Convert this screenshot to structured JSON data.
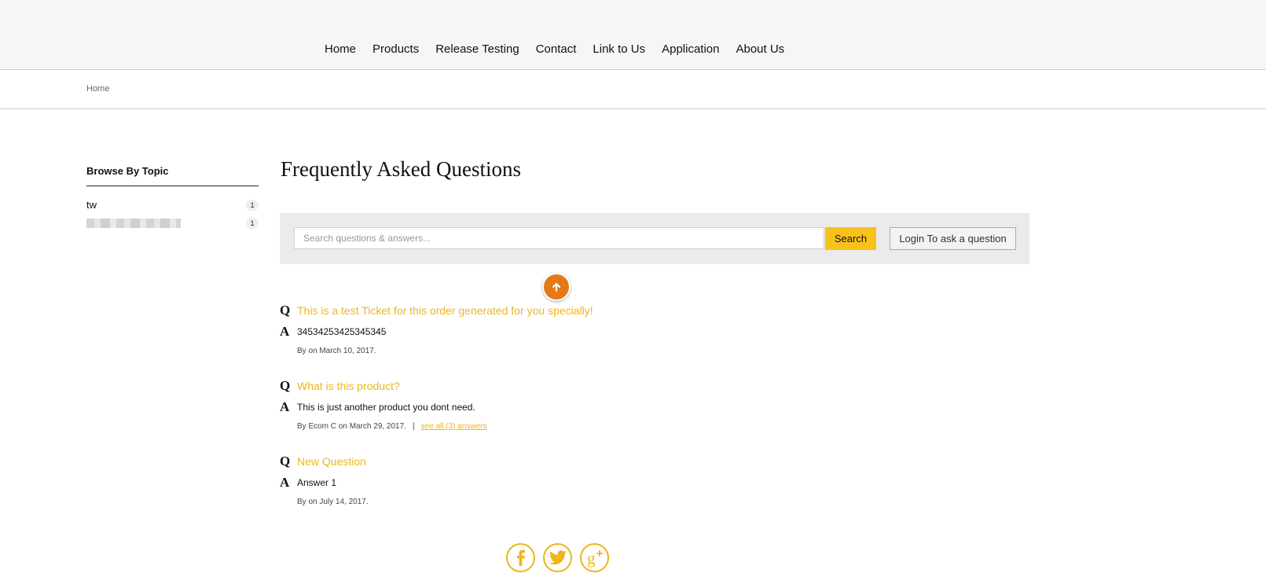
{
  "nav": {
    "items": [
      {
        "label": "Home"
      },
      {
        "label": "Products"
      },
      {
        "label": "Release Testing"
      },
      {
        "label": "Contact"
      },
      {
        "label": "Link to Us"
      },
      {
        "label": "Application"
      },
      {
        "label": "About Us"
      }
    ]
  },
  "breadcrumb": {
    "home": "Home"
  },
  "sidebar": {
    "title": "Browse By Topic",
    "topics": [
      {
        "label": "tw",
        "count": "1"
      },
      {
        "label": "",
        "count": "1"
      }
    ]
  },
  "main": {
    "title": "Frequently Asked Questions",
    "search": {
      "placeholder": "Search questions & answers...",
      "button_label": "Search",
      "login_label": "Login To ask a question"
    },
    "qa_letters": {
      "q": "Q",
      "a": "A"
    },
    "questions": [
      {
        "question": "This is a test Ticket for this order generated for you specially!",
        "answer": "34534253425345345",
        "meta": "By on March 10, 2017."
      },
      {
        "question": "What is this product?",
        "answer": "This is just another product you dont need.",
        "meta": "By Ecom C on March 29, 2017.",
        "separator": "|",
        "link": "see all (3) answers"
      },
      {
        "question": "New Question",
        "answer": "Answer 1",
        "meta": "By on July 14, 2017."
      }
    ]
  },
  "icons": {
    "scroll_up": "arrow-up-icon",
    "social": [
      "facebook-icon",
      "twitter-icon",
      "google-plus-icon"
    ]
  },
  "colors": {
    "accent": "#f8c21c",
    "link": "#f0b51c",
    "scroll_button": "#e47a17"
  }
}
